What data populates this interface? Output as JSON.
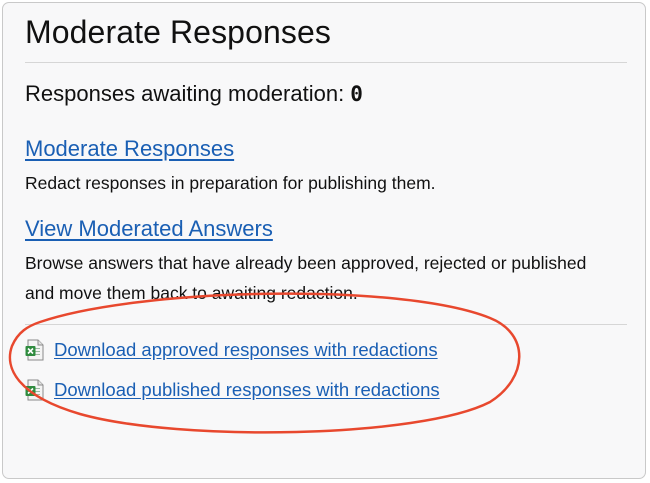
{
  "panel": {
    "title": "Moderate Responses",
    "awaiting_label": "Responses awaiting moderation: ",
    "awaiting_count": "0"
  },
  "links": [
    {
      "label": "Moderate Responses",
      "description": "Redact responses in preparation for publishing them."
    },
    {
      "label": "View Moderated Answers",
      "description": "Browse answers that have already been approved, rejected or published and move them back to awaiting redaction."
    }
  ],
  "downloads": [
    {
      "label": "Download approved responses with redactions",
      "icon": "spreadsheet-icon"
    },
    {
      "label": "Download published responses with redactions",
      "icon": "spreadsheet-icon"
    }
  ],
  "colors": {
    "link": "#1a5fb4",
    "annotation": "#e8482e",
    "panel_bg": "#f8f8f9"
  }
}
